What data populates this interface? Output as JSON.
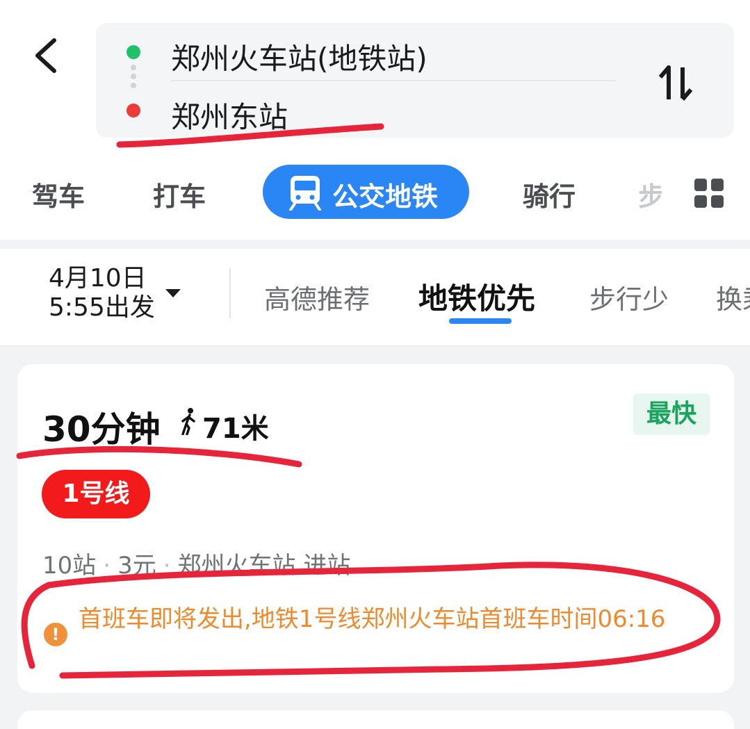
{
  "route": {
    "from": "郑州火车站(地铁站)",
    "to": "郑州东站"
  },
  "modes": {
    "drive": "驾车",
    "taxi": "打车",
    "transit": "公交地铁",
    "ride": "骑行",
    "walk": "步"
  },
  "filters": {
    "date": "4月10日",
    "time": "5:55出发",
    "options": [
      "高德推荐",
      "地铁优先",
      "步行少",
      "换乘"
    ]
  },
  "result": {
    "duration": "30分钟",
    "walk": "71米",
    "badge": "最快",
    "line": "1号线",
    "stops": "10站",
    "fare": "3元",
    "station": "郑州火车站 进站",
    "alert": "首班车即将发出,地铁1号线郑州火车站首班车时间06:16"
  },
  "colors": {
    "accent": "#2b86f5",
    "line1": "#f21a1a",
    "fastest": "#1aa55f",
    "alert": "#ef8a2c",
    "annotation": "#e8243a"
  }
}
